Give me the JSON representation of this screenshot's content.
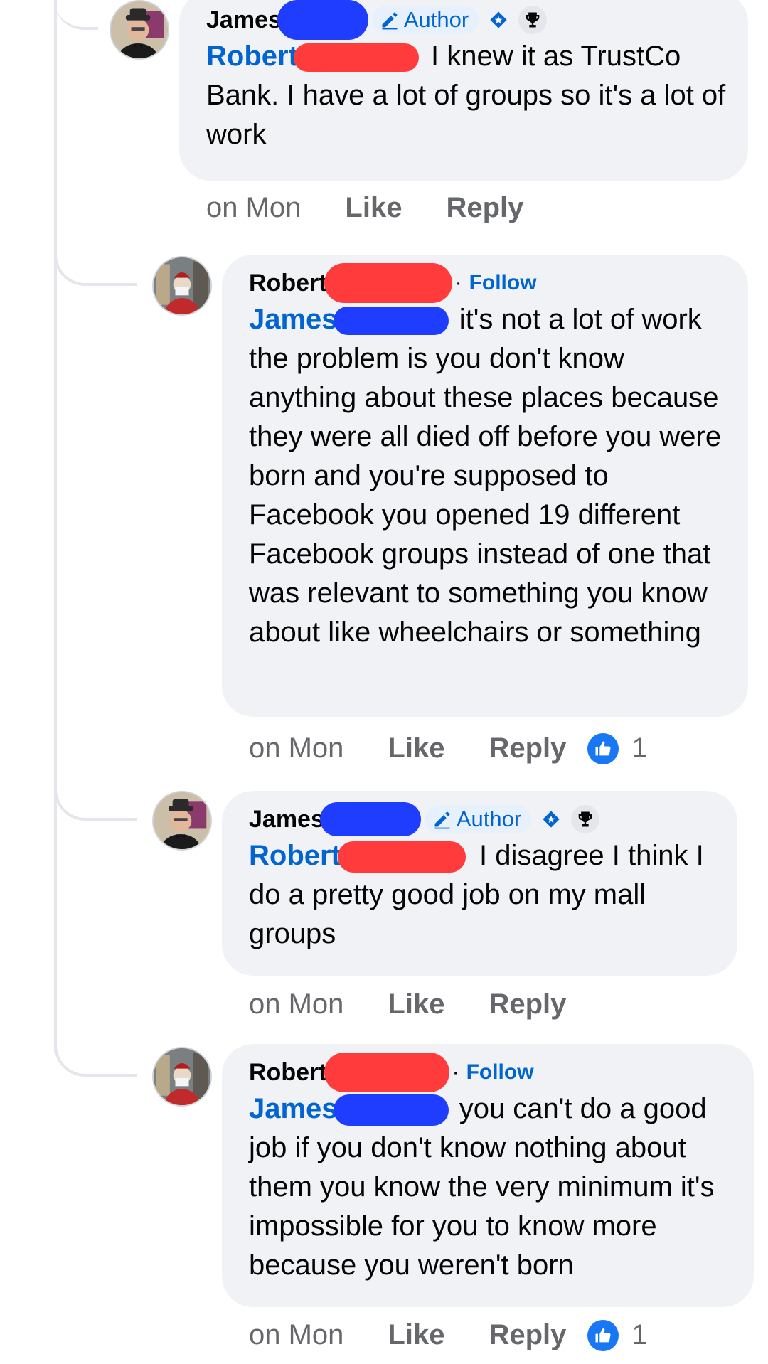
{
  "comments": [
    {
      "author": "James",
      "author_badge": "Author",
      "mention": "Robert",
      "text": "I knew it as TrustCo Bank. I have a lot of groups so it's a lot of work",
      "time": "on Mon",
      "like_label": "Like",
      "reply_label": "Reply"
    },
    {
      "author": "Robert",
      "separator": "·",
      "follow_label": "Follow",
      "mention": "James",
      "text": "it's not a lot of work the problem is you don't know anything about these places because they were all died off before you were born and you're supposed to Facebook you opened 19 different Facebook groups instead of one that was relevant to something you know about like wheelchairs or something",
      "time": "on Mon",
      "like_label": "Like",
      "reply_label": "Reply",
      "reaction_count": "1"
    },
    {
      "author": "James",
      "author_badge": "Author",
      "mention": "Robert",
      "text": "I disagree I think I do a pretty good job on my mall groups",
      "time": "on Mon",
      "like_label": "Like",
      "reply_label": "Reply"
    },
    {
      "author": "Robert",
      "separator": "·",
      "follow_label": "Follow",
      "mention": "James",
      "text": "you can't do a good job if you don't know nothing about them you know the very minimum it's impossible for you to know more because you weren't born",
      "time": "on Mon",
      "like_label": "Like",
      "reply_label": "Reply",
      "reaction_count": "1"
    }
  ],
  "colors": {
    "bubble": "#f0f2f5",
    "link": "#0064d1",
    "muted": "#65676b",
    "like_blue": "#1877f2",
    "redact_blue": "#1f3dff",
    "redact_red": "#ff3b3b"
  }
}
